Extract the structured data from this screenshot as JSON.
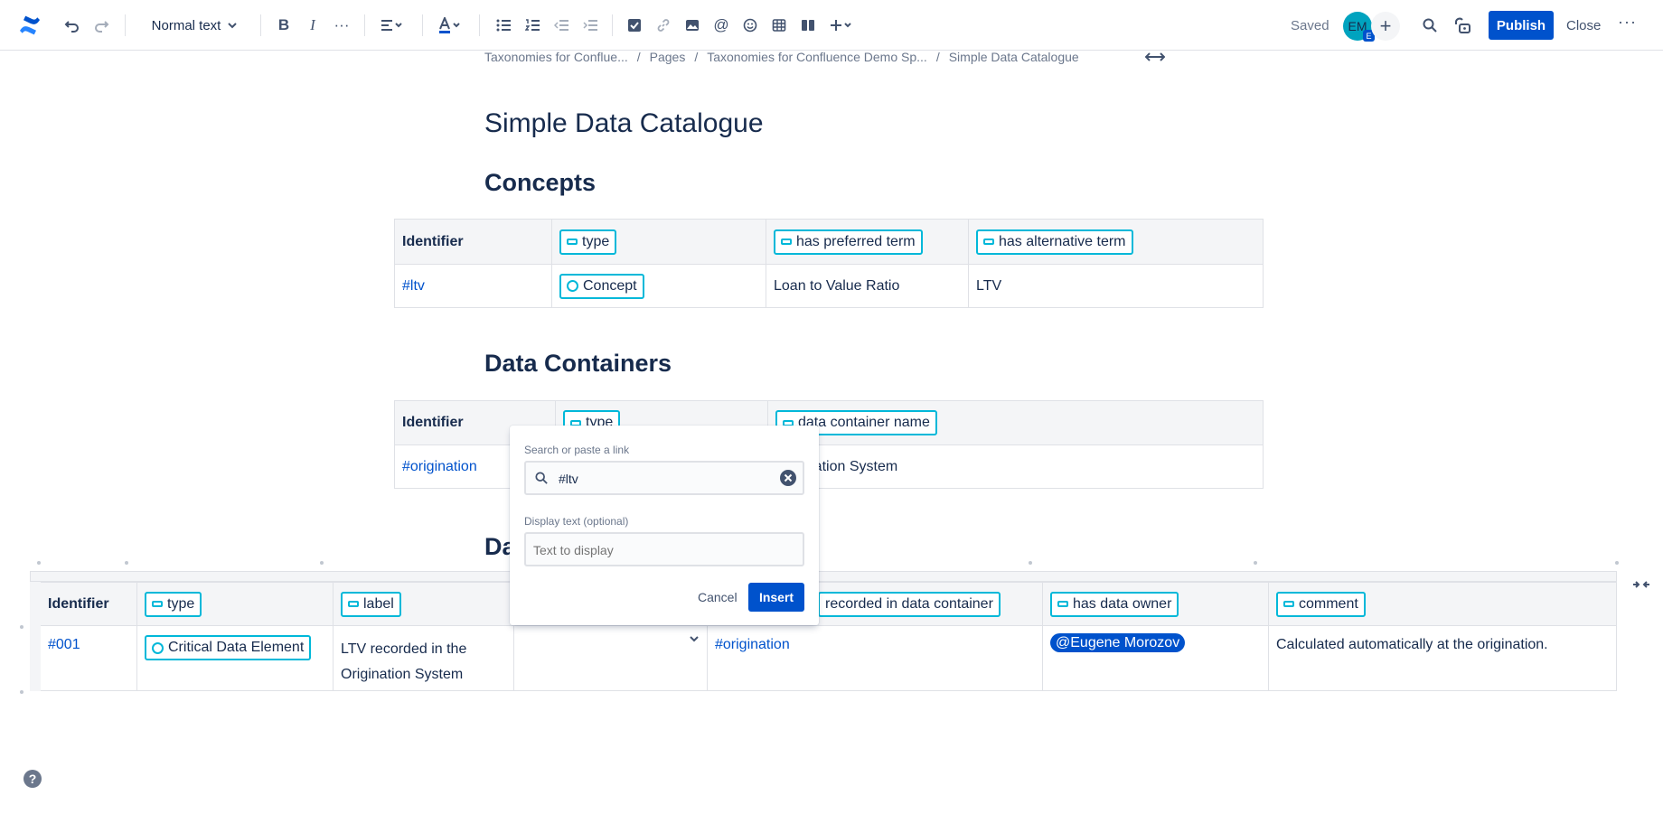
{
  "toolbar": {
    "text_style": "Normal text",
    "saved": "Saved",
    "avatar_initials": "EM",
    "avatar_badge": "E",
    "publish": "Publish",
    "close": "Close"
  },
  "breadcrumb": [
    "Taxonomies for Conflue...",
    "Pages",
    "Taxonomies for Confluence Demo Sp...",
    "Simple Data Catalogue"
  ],
  "page_title": "Simple Data Catalogue",
  "concepts": {
    "heading": "Concepts",
    "headers": [
      "Identifier",
      "type",
      "has preferred term",
      "has alternative term"
    ],
    "row": [
      "#ltv",
      "Concept",
      "Loan to Value Ratio",
      "LTV"
    ]
  },
  "containers": {
    "heading": "Data Containers",
    "headers": [
      "Identifier",
      "type",
      "data container name"
    ],
    "row": [
      "#origination",
      "",
      "Origination System"
    ]
  },
  "elements": {
    "heading": "Da",
    "headers": [
      "Identifier",
      "type",
      "label",
      "",
      "recorded in data container",
      "has data owner",
      "comment"
    ],
    "row": [
      "#001",
      "Critical Data Element",
      "LTV recorded in the Origination System",
      "",
      "#origination",
      "@Eugene Morozov",
      "Calculated automatically at the origination."
    ]
  },
  "dialog": {
    "search_label": "Search or paste a link",
    "search_value": "#ltv",
    "display_label": "Display text (optional)",
    "display_placeholder": "Text to display",
    "cancel": "Cancel",
    "insert": "Insert"
  },
  "help": "?",
  "colors": {
    "primary": "#0052cc",
    "tag_border": "#00b8d9",
    "header_bg": "#f4f5f7"
  }
}
